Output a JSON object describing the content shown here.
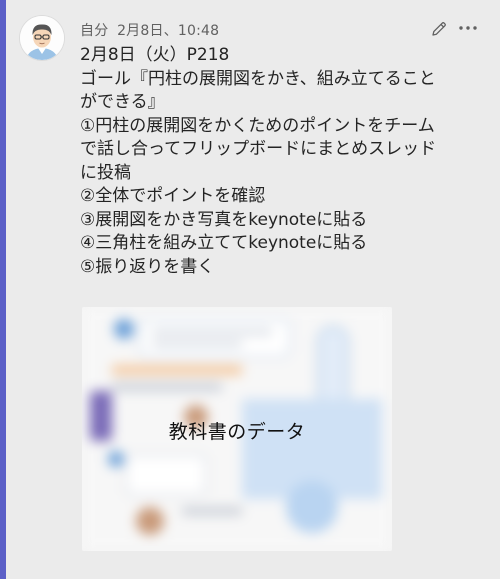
{
  "post": {
    "author": "自分",
    "timestamp": "2月8日、10:48",
    "lines": [
      "2月8日（火）P218",
      "ゴール『円柱の展開図をかき、組み立てること",
      "ができる』",
      "①円柱の展開図をかくためのポイントをチーム",
      "で話し合ってフリップボードにまとめスレッド",
      "に投稿",
      "②全体でポイントを確認",
      "③展開図をかき写真をkeynoteに貼る",
      "④三角柱を組み立ててkeynoteに貼る",
      "⑤振り返りを書く"
    ],
    "attachment_label": "教科書のデータ"
  },
  "icons": {
    "avatar": "avatar-illustration",
    "edit": "pencil-icon",
    "more": "more-horizontal-icon"
  },
  "colors": {
    "accent": "#5b5fc7",
    "background": "#ebebeb",
    "text": "#242424",
    "meta": "#616161"
  }
}
